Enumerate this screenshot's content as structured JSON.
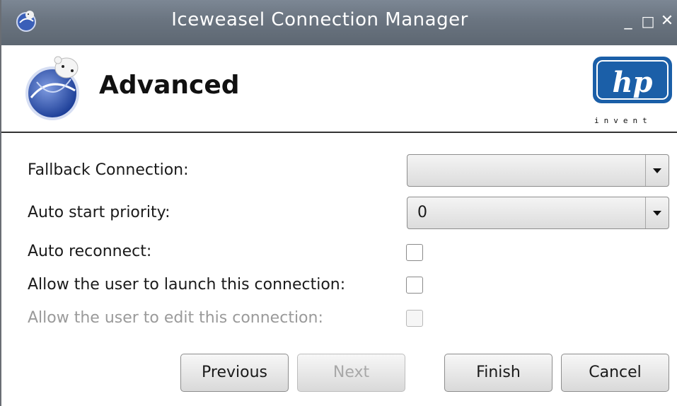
{
  "window": {
    "title": "Iceweasel Connection Manager",
    "controls": {
      "minimize": "_",
      "maximize": "□",
      "close": "✕"
    }
  },
  "header": {
    "title": "Advanced",
    "logo_text": "hp",
    "logo_tagline": "invent",
    "app_icon": "iceweasel-icon"
  },
  "form": {
    "fallback_connection": {
      "label": "Fallback Connection:",
      "value": ""
    },
    "auto_start_priority": {
      "label": "Auto start priority:",
      "value": "0"
    },
    "auto_reconnect": {
      "label": "Auto reconnect:",
      "checked": false
    },
    "allow_launch": {
      "label": "Allow the user to launch this connection:",
      "checked": false
    },
    "allow_edit": {
      "label": "Allow the user to edit this connection:",
      "checked": false,
      "disabled": true
    }
  },
  "buttons": {
    "previous": "Previous",
    "next": "Next",
    "finish": "Finish",
    "cancel": "Cancel"
  },
  "colors": {
    "titlebar": "#6a7480",
    "hp_blue": "#1b5fa8"
  }
}
